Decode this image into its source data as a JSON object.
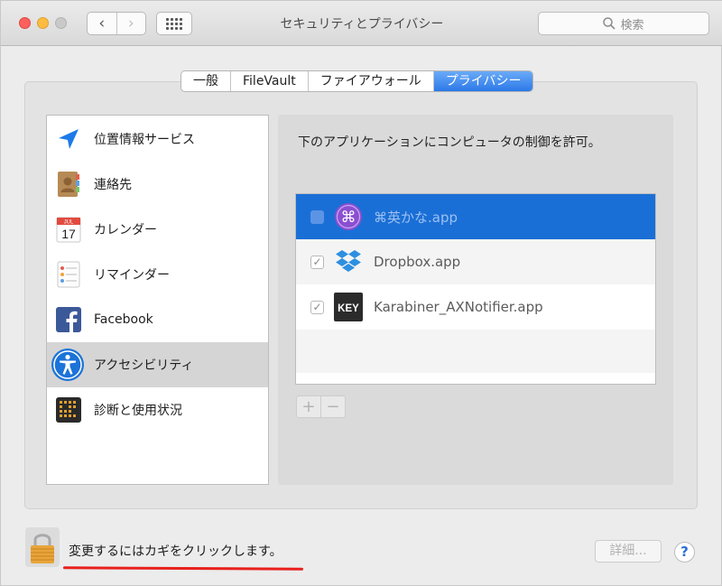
{
  "window": {
    "title": "セキュリティとプライバシー",
    "search_placeholder": "検索",
    "nav_back": "‹",
    "nav_forward": "›"
  },
  "tabs": [
    {
      "label": "一般",
      "active": false
    },
    {
      "label": "FileVault",
      "active": false
    },
    {
      "label": "ファイアウォール",
      "active": false
    },
    {
      "label": "プライバシー",
      "active": true
    }
  ],
  "sidebar": {
    "items": [
      {
        "label": "位置情報サービス",
        "icon": "location-icon"
      },
      {
        "label": "連絡先",
        "icon": "contacts-icon"
      },
      {
        "label": "カレンダー",
        "icon": "calendar-icon",
        "icon_month": "JUL",
        "icon_day": "17"
      },
      {
        "label": "リマインダー",
        "icon": "reminders-icon"
      },
      {
        "label": "Facebook",
        "icon": "facebook-icon"
      },
      {
        "label": "アクセシビリティ",
        "icon": "accessibility-icon",
        "selected": true
      },
      {
        "label": "診断と使用状況",
        "icon": "diagnostics-icon"
      }
    ]
  },
  "panel": {
    "title": "下のアプリケーションにコンピュータの制御を許可。",
    "apps": [
      {
        "name": "⌘英かな.app",
        "checked": false,
        "selected": true,
        "icon": "eikana-icon",
        "icon_text": "⌘"
      },
      {
        "name": "Dropbox.app",
        "checked": true,
        "selected": false,
        "icon": "dropbox-icon",
        "check_mark": "✓"
      },
      {
        "name": "Karabiner_AXNotifier.app",
        "checked": true,
        "selected": false,
        "icon": "karabiner-key-icon",
        "icon_text": "KEY",
        "check_mark": "✓"
      }
    ],
    "add_label": "+",
    "remove_label": "−"
  },
  "footer": {
    "lock_message": "変更するにはカギをクリックします。",
    "details_label": "詳細...",
    "help_label": "?"
  },
  "colors": {
    "accent": "#2c79e8",
    "selection": "#1a6fd6",
    "annotation": "#e8201d"
  }
}
